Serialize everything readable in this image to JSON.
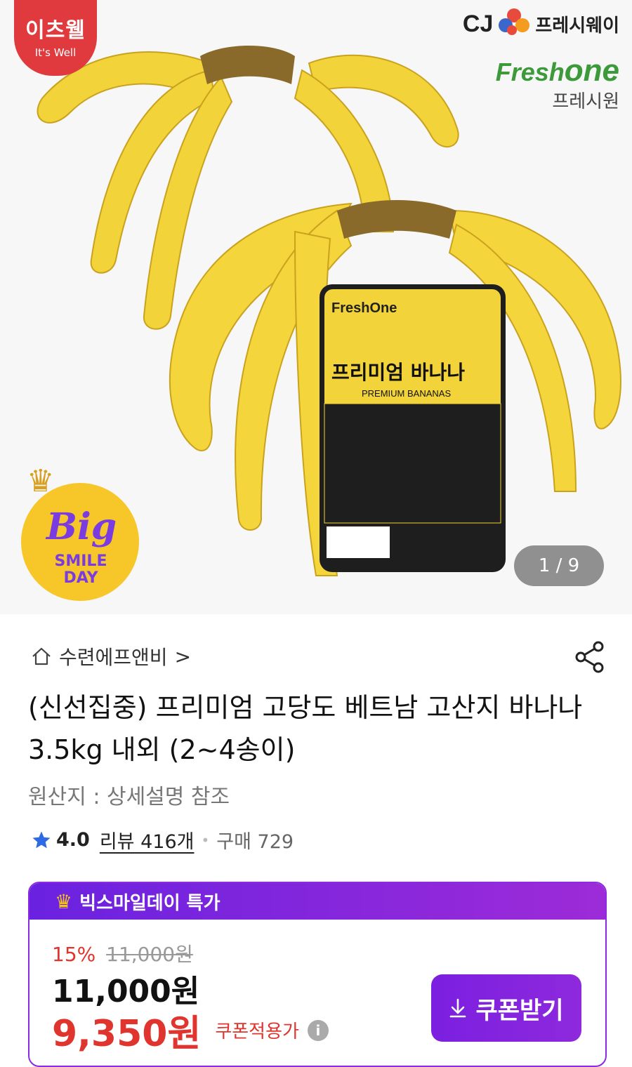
{
  "hero": {
    "badge_korean": "이츠웰",
    "badge_english": "It's Well",
    "cj_text": "CJ",
    "cj_sub": "프레시웨이",
    "freshone_a": "Fresh",
    "freshone_b": "one",
    "freshone_sub": "프레시원",
    "bigsmile_big": "Big",
    "bigsmile_smile": "SMILE",
    "bigsmile_day": "DAY",
    "pager": "1 / 9"
  },
  "store": {
    "name": "수련에프앤비",
    "chevron": ">"
  },
  "product": {
    "title": "(신선집중) 프리미엄 고당도 베트남 고산지 바나나 3.5kg 내외 (2~4송이)",
    "origin": "원산지 : 상세설명 참조"
  },
  "rating": {
    "score": "4.0",
    "review": "리뷰 416개",
    "buy": "구매 729"
  },
  "deal": {
    "header": "빅스마일데이 특가",
    "discount_pct": "15%",
    "original_price": "11,000원",
    "price": "11,000원",
    "coupon_price": "9,350원",
    "coupon_label": "쿠폰적용가",
    "coupon_button": "쿠폰받기"
  },
  "colors": {
    "accent_purple": "#8b2be2",
    "sale_red": "#e0342e",
    "badge_red": "#e03a3e",
    "freshone_green": "#3c9a3a"
  }
}
